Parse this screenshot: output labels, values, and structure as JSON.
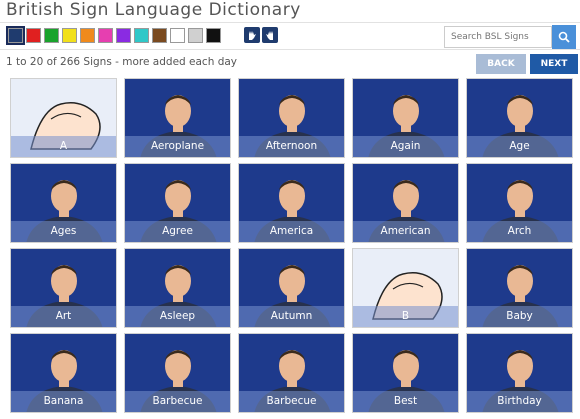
{
  "header": {
    "title": "British Sign Language Dictionary"
  },
  "toolbar": {
    "swatches": [
      "#1f3b6e",
      "#e02020",
      "#19a32c",
      "#f2e01a",
      "#f08a1c",
      "#e63fb0",
      "#8a2be2",
      "#2fc8c8",
      "#7a4a1f",
      "#ffffff",
      "#d0d0d0",
      "#111111"
    ],
    "hand_buttons": [
      "right-hand-icon",
      "left-hand-icon"
    ],
    "search_placeholder": "Search BSL Signs"
  },
  "results": {
    "count_text": "1 to 20 of 266 Signs - more added each day",
    "back_label": "BACK",
    "next_label": "NEXT"
  },
  "signs": [
    "A",
    "Aeroplane",
    "Afternoon",
    "Again",
    "Age",
    "Ages",
    "Agree",
    "America",
    "American",
    "Arch",
    "Art",
    "Asleep",
    "Autumn",
    "B",
    "Baby",
    "Banana",
    "Barbecue",
    "Barbecue",
    "Best",
    "Birthday"
  ],
  "colors": {
    "tile": "#1e3a8c",
    "accent": "#4a90d9",
    "next": "#1f5aa6",
    "back": "#a9bcd6"
  }
}
